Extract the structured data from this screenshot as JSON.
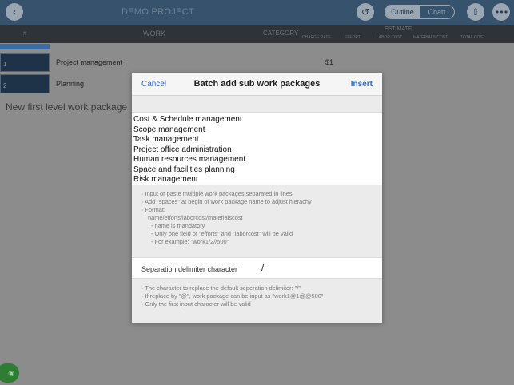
{
  "header": {
    "project_title": "DEMO PROJECT",
    "back_icon": "chevron-left-icon",
    "undo_icon": "undo-icon",
    "share_icon": "share-icon",
    "more_icon": "more-icon",
    "segments": [
      "Outline",
      "Chart"
    ],
    "active_segment": "Outline"
  },
  "columns": {
    "num": "#",
    "work": "WORK",
    "category": "CATEGORY",
    "estimate": "ESTIMATE",
    "charge_rate": "CHARGE RATE",
    "effort": "EFFORT",
    "labor_cost": "LABOR COST",
    "materials_cost": "MATERIALS COST",
    "total_cost": "TOTAL COST"
  },
  "rows": [
    {
      "num": "1",
      "label": "Project management",
      "cost": "$1"
    },
    {
      "num": "2",
      "label": "Planning",
      "cost": ""
    }
  ],
  "new_package": "New first level work package",
  "modal": {
    "title": "Batch add sub work packages",
    "cancel": "Cancel",
    "insert": "Insert",
    "packages": [
      "Cost & Schedule management",
      "Scope management",
      "Task management",
      "Project office administration",
      "Human resources management",
      "Space and facilities planning",
      "Risk management"
    ],
    "help": [
      "· Input or paste multiple work packages separated in lines",
      "· Add \"spaces\" at begin of work package name to adjust hierachy",
      "· Format:",
      "name/efforts/laborcost/materialscost",
      "- name is mandatory",
      "- Only one field of \"efforts\" and \"laborcost\" will be valid",
      "- For example: \"work1/2//500\""
    ],
    "delimiter_label": "Separation delimiter character",
    "delimiter_value": "/",
    "delimiter_help": [
      "· The character to replace the default seperation delimiter: \"/\"",
      "· If replace by \"@\", work package can be input as \"work1@1@@500\"",
      "· Only the first input character will be valid"
    ]
  },
  "colors": {
    "topbar": "#37526c",
    "accent": "#2a6bd6",
    "fab": "#2e7d32"
  }
}
